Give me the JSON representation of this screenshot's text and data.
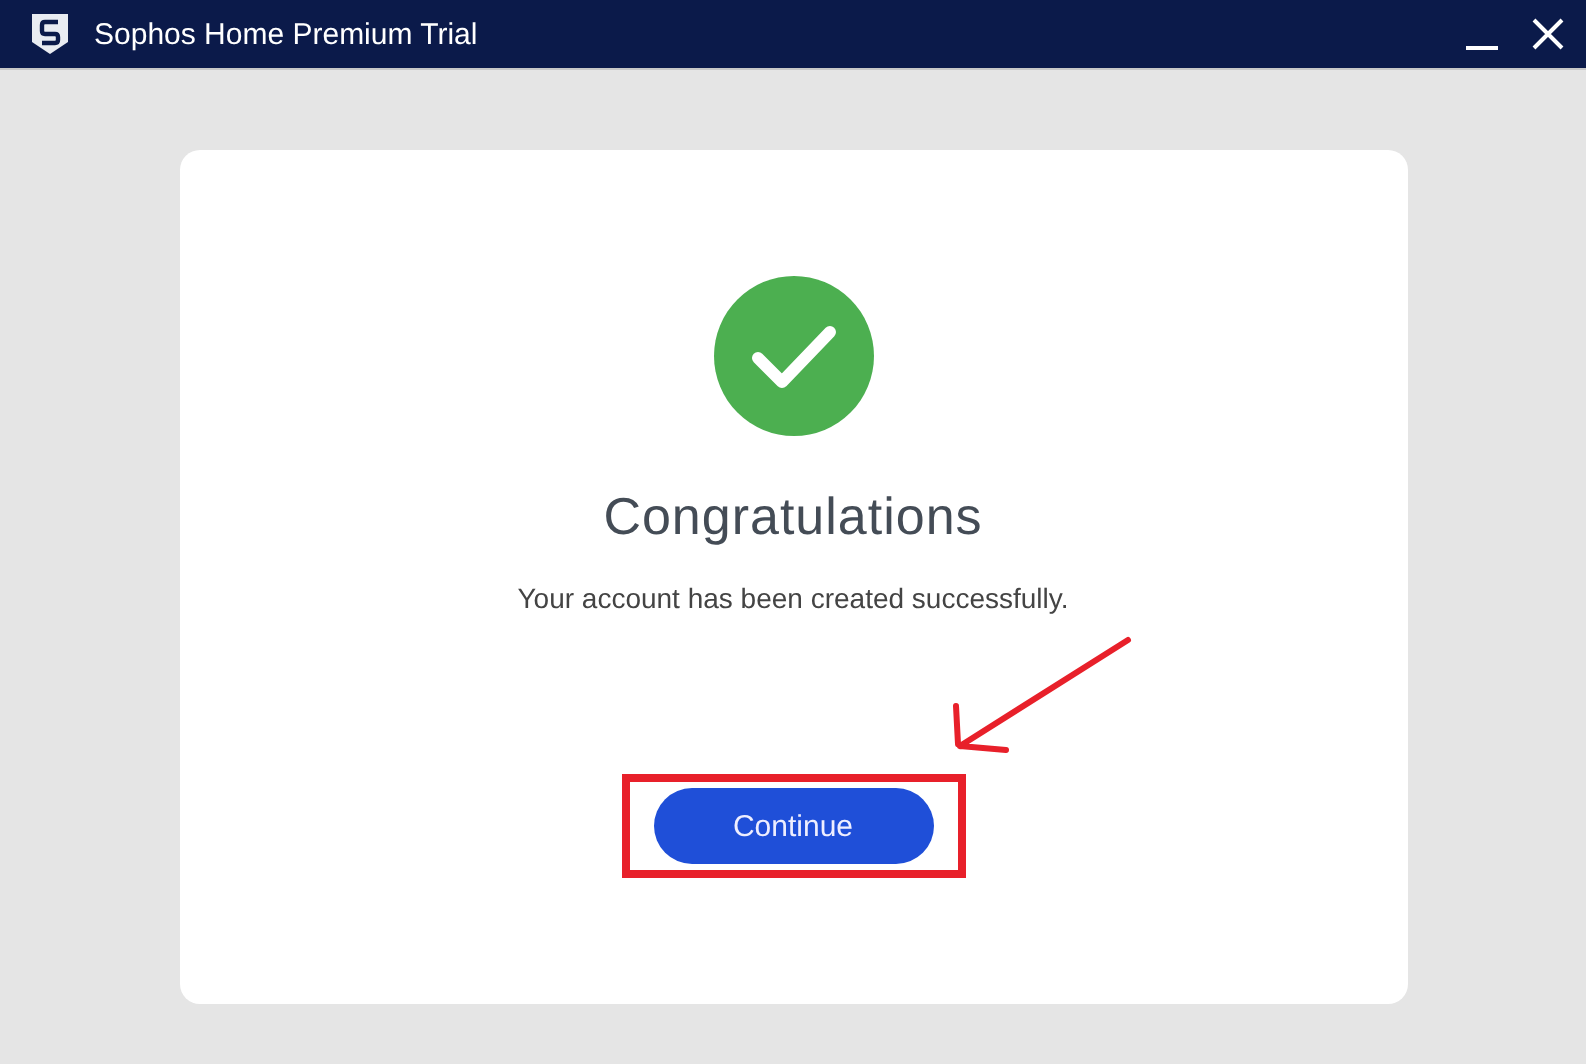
{
  "window": {
    "title": "Sophos Home Premium Trial"
  },
  "card": {
    "heading": "Congratulations",
    "message": "Your account has been created successfully.",
    "button": "Continue"
  }
}
